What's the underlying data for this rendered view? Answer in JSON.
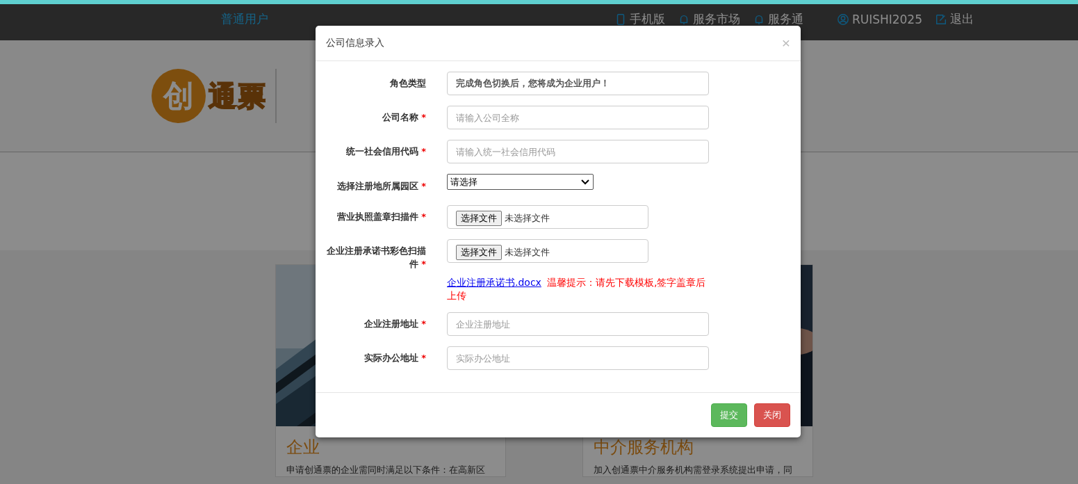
{
  "nav": {
    "role": "普通用户",
    "links": [
      {
        "label": "手机版"
      },
      {
        "label": "服务市场"
      },
      {
        "label": "服务通"
      },
      {
        "label": "RUISHI2025"
      },
      {
        "label": "退出"
      }
    ]
  },
  "logo": {
    "mark": "创",
    "name": "通票"
  },
  "cards": [
    {
      "title": "企业",
      "text": "申请创通票的企业需同时满足以下条件：在高新区"
    },
    {
      "title": "中介服务机构",
      "text": "加入创通票中介服务机构需登录系统提出申请，同"
    }
  ],
  "dialog": {
    "title": "公司信息录入",
    "close": "×",
    "fields": [
      {
        "kind": "readonly",
        "label": "角色类型",
        "value": "完成角色切换后，您将成为企业用户！"
      },
      {
        "kind": "text",
        "label": "公司名称",
        "required_mark": "*",
        "placeholder": "请输入公司全称"
      },
      {
        "kind": "text",
        "label": "统一社会信用代码",
        "required_mark": "*",
        "placeholder": "请输入统一社会信用代码"
      },
      {
        "kind": "select",
        "label": "选择注册地所属园区",
        "required_mark": "*",
        "value": "请选择"
      },
      {
        "kind": "file",
        "label": "营业执照盖章扫描件",
        "required_mark": "*",
        "button": "选择文件",
        "status": "未选择文件"
      },
      {
        "kind": "file",
        "label": "企业注册承诺书彩色扫描件",
        "required_mark": "*",
        "button": "选择文件",
        "status": "未选择文件",
        "link": "企业注册承诺书.docx",
        "note": "温馨提示：请先下载模板,签字盖章后上传"
      },
      {
        "kind": "text",
        "label": "企业注册地址",
        "required_mark": "*",
        "placeholder": "企业注册地址"
      },
      {
        "kind": "text",
        "label": "实际办公地址",
        "required_mark": "*",
        "placeholder": "实际办公地址"
      }
    ],
    "buttons": [
      {
        "kind": "primary",
        "label": "提交"
      },
      {
        "kind": "danger",
        "label": "关闭"
      }
    ]
  }
}
